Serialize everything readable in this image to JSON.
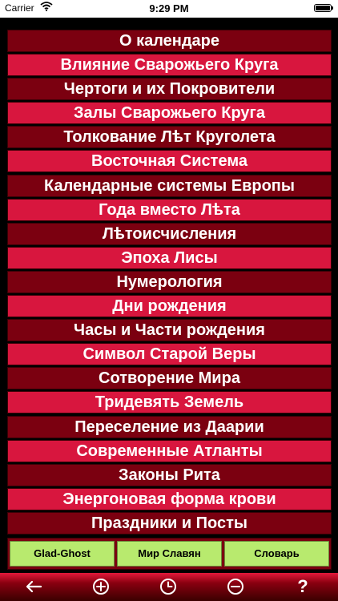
{
  "status_bar": {
    "carrier": "Carrier",
    "time": "9:29 PM"
  },
  "menu": {
    "items": [
      "О календаре",
      "Влияние Сварожьего Круга",
      "Чертоги и их Покровители",
      "Залы Сварожьего Круга",
      "Толкование Лѣт Круголета",
      "Восточная Система",
      "Календарные системы Европы",
      "Года вместо Лѣта",
      "Лѣтоисчисления",
      "Эпоха Лисы",
      "Нумерология",
      "Дни рождения",
      "Часы и Части рождения",
      "Символ Старой Веры",
      "Сотворение Мира",
      "Тридевять Земель",
      "Переселение из Даарии",
      "Современные Атланты",
      "Законы Рита",
      "Энергоновая форма крови",
      "Праздники и Посты"
    ]
  },
  "bottom_buttons": {
    "glad_ghost": "Glad-Ghost",
    "mir_slavyan": "Мир Славян",
    "slovar": "Словарь"
  },
  "toolbar": {
    "icons": [
      "back-arrow-icon",
      "zoom-in-icon",
      "clock-icon",
      "zoom-out-icon",
      "help-icon"
    ],
    "help_label": "?"
  },
  "colors": {
    "dark_row": "#7b0010",
    "light_row": "#d8163e",
    "button_green": "#b8ea6e"
  }
}
